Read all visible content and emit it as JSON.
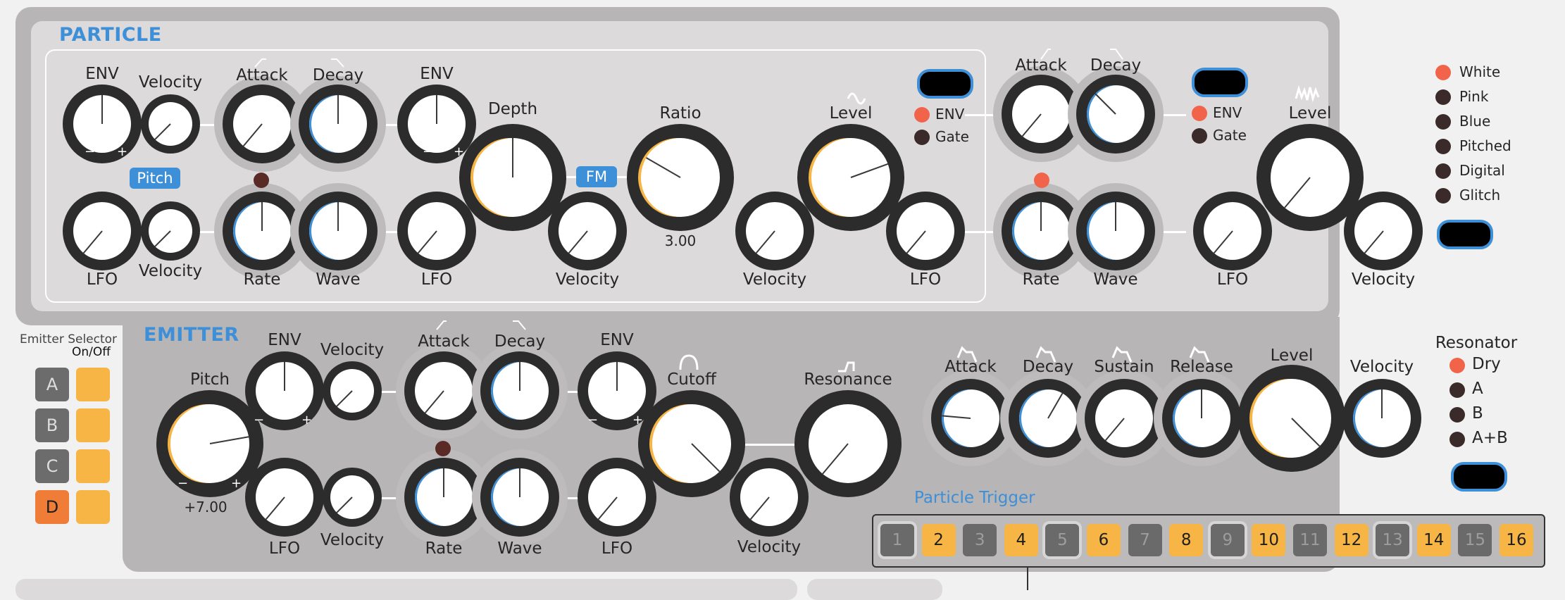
{
  "particle": {
    "title": "PARTICLE",
    "env_label": "ENV",
    "velocity_label": "Velocity",
    "lfo_label": "LFO",
    "pitch_tag": "Pitch",
    "attack_label": "Attack",
    "decay_label": "Decay",
    "rate_label": "Rate",
    "wave_label": "Wave",
    "depth_label": "Depth",
    "fm_tag": "FM",
    "ratio_label": "Ratio",
    "ratio_value": "3.00",
    "level_label": "Level",
    "env_option": "ENV",
    "gate_option": "Gate",
    "noise_types": [
      "White",
      "Pink",
      "Blue",
      "Pitched",
      "Digital",
      "Glitch"
    ],
    "noise_selected": "White"
  },
  "emitter": {
    "title": "EMITTER",
    "pitch_label": "Pitch",
    "pitch_value": "+7.00",
    "env_label": "ENV",
    "velocity_label": "Velocity",
    "lfo_label": "LFO",
    "attack_label": "Attack",
    "decay_label": "Decay",
    "sustain_label": "Sustain",
    "release_label": "Release",
    "rate_label": "Rate",
    "wave_label": "Wave",
    "cutoff_label": "Cutoff",
    "resonance_label": "Resonance",
    "level_label": "Level",
    "resonator_title": "Resonator",
    "resonator_options": [
      "Dry",
      "A",
      "B",
      "A+B"
    ],
    "resonator_selected": "Dry"
  },
  "emitter_selector": {
    "title": "Emitter Selector",
    "subtitle": "On/Off",
    "emitters": [
      "A",
      "B",
      "C",
      "D"
    ],
    "active": "D"
  },
  "particle_trigger": {
    "title": "Particle Trigger",
    "steps": [
      "1",
      "2",
      "3",
      "4",
      "5",
      "6",
      "7",
      "8",
      "9",
      "10",
      "11",
      "12",
      "13",
      "14",
      "15",
      "16"
    ],
    "active_steps": [
      2,
      4,
      6,
      8,
      10,
      12,
      14,
      16
    ]
  },
  "symbols": {
    "minus": "−",
    "plus": "+"
  },
  "colors": {
    "accent_blue": "#3d8fd8",
    "accent_orange": "#f6b545",
    "selected_red": "#f2644a",
    "selector_active": "#ef7d37"
  }
}
